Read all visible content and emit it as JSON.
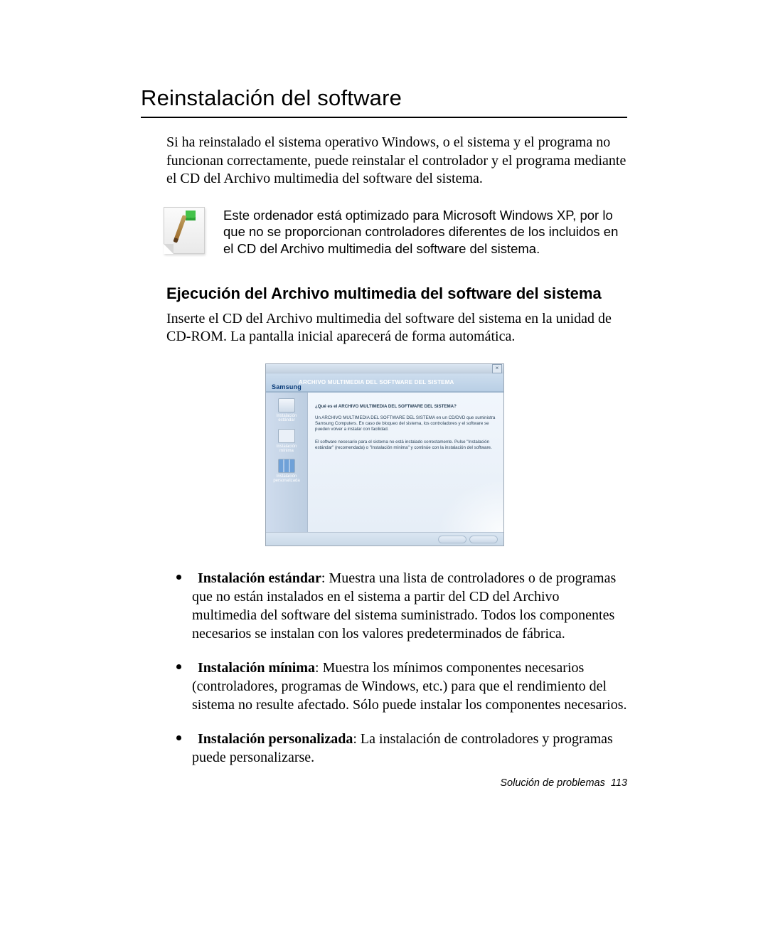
{
  "page": {
    "title": "Reinstalación del software",
    "intro": "Si ha reinstalado el sistema operativo Windows, o el sistema y el programa no funcionan correctamente, puede reinstalar el controlador y el programa mediante el CD del Archivo multimedia del software del sistema.",
    "note": "Este ordenador está optimizado para Microsoft Windows XP, por lo que no se proporcionan controladores diferentes de los incluidos en el CD del Archivo multimedia del software del sistema.",
    "subheading": "Ejecución del Archivo multimedia del software del sistema",
    "subtext": "Inserte el CD del Archivo multimedia del software del sistema en la unidad de CD-ROM. La pantalla inicial aparecerá de forma automática."
  },
  "shot": {
    "brand": "Samsung",
    "title": "ARCHIVO MULTIMEDIA DEL SOFTWARE DEL SISTEMA",
    "close": "×",
    "side": [
      "Instalación estándar",
      "Instalación mínima",
      "Instalación personalizada"
    ],
    "q": "¿Qué es el ARCHIVO MULTIMEDIA DEL SOFTWARE DEL SISTEMA?",
    "p1": "Un ARCHIVO MULTIMEDIA DEL SOFTWARE DEL SISTEMA en un CD/DVD que suministra Samsung Computers. En caso de bloqueo del sistema, los controladores y el software se pueden volver a instalar con facilidad.",
    "p2": "El software necesario para el sistema no está instalado correctamente. Pulse \"Instalación estándar\" (recomendada) o \"Instalación mínima\" y continúe con la instalación del software."
  },
  "bullets": [
    {
      "label": "Instalación estándar",
      "text": ": Muestra una lista de controladores o de programas que no están instalados en el sistema a partir del CD del Archivo multimedia del software del sistema suministrado. Todos los componentes necesarios se instalan con los valores predeterminados de fábrica."
    },
    {
      "label": "Instalación mínima",
      "text": ": Muestra los mínimos componentes necesarios (controladores, programas de Windows, etc.) para que el rendimiento del sistema no resulte afectado. Sólo puede instalar los componentes necesarios."
    },
    {
      "label": "Instalación personalizada",
      "text": ": La instalación de controladores y programas puede personalizarse."
    }
  ],
  "footer": {
    "section": "Solución de problemas",
    "page_number": "113"
  }
}
